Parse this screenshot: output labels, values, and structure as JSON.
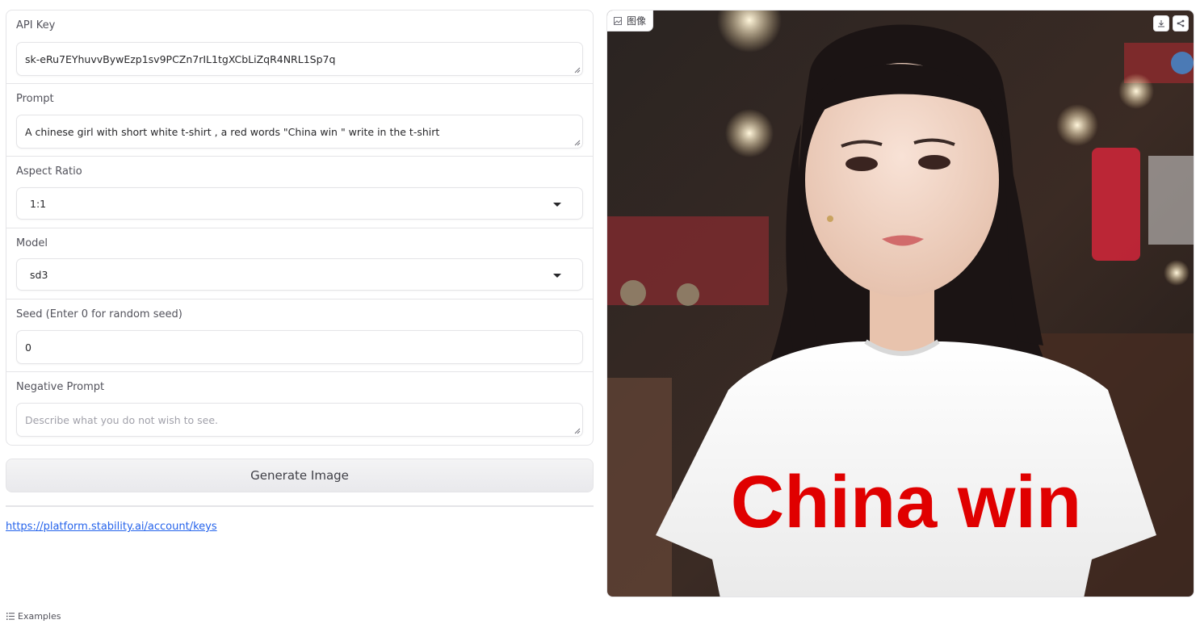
{
  "form": {
    "api_key": {
      "label": "API Key",
      "value": "sk-eRu7EYhuvvBywEzp1sv9PCZn7rIL1tgXCbLiZqR4NRL1Sp7q"
    },
    "prompt": {
      "label": "Prompt",
      "value": "A chinese girl with short white t-shirt , a red words \"China win \" write in the t-shirt"
    },
    "aspect_ratio": {
      "label": "Aspect Ratio",
      "value": "1:1"
    },
    "model": {
      "label": "Model",
      "value": "sd3"
    },
    "seed": {
      "label": "Seed (Enter 0 for random seed)",
      "value": "0"
    },
    "negative_prompt": {
      "label": "Negative Prompt",
      "placeholder": "Describe what you do not wish to see."
    }
  },
  "generate_button": {
    "label": "Generate Image"
  },
  "link": {
    "text": "https://platform.stability.ai/account/keys"
  },
  "examples": {
    "label": "Examples",
    "icon": "list-icon"
  },
  "output": {
    "label": "图像",
    "label_icon": "image-icon",
    "shirt_text": "China win",
    "actions": [
      "download-icon",
      "share-icon"
    ]
  },
  "colors": {
    "link": "#2563eb",
    "shirt_text": "#e00000",
    "border": "#e4e4e7"
  }
}
